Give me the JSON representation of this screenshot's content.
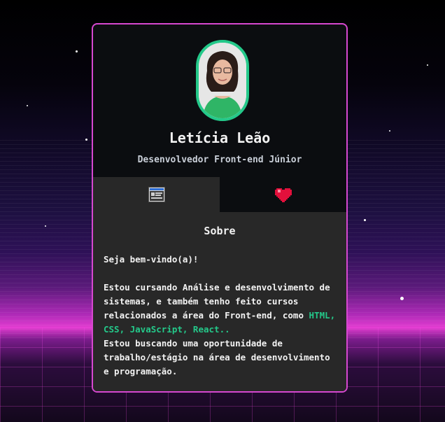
{
  "profile": {
    "name": "Letícia Leão",
    "role": "Desenvolvedor Front-end Júnior"
  },
  "tabs": [
    {
      "icon": "profile-card-icon",
      "active": true
    },
    {
      "icon": "heart-icon",
      "active": false
    }
  ],
  "about": {
    "title": "Sobre",
    "greeting": "Seja bem-vindo(a)!",
    "text1": "Estou cursando Análise e desenvolvimento de sistemas, e também tenho feito cursos relacionados a área do Front-end, como",
    "tech": "HTML, CSS, JavaScript, React..",
    "text2": "Estou buscando uma oportunidade de trabalho/estágio na área de desenvolvimento e programação."
  },
  "colors": {
    "accent": "#24c98a",
    "border": "#d648d0",
    "card": "#0b0d10",
    "panel": "#282828"
  }
}
